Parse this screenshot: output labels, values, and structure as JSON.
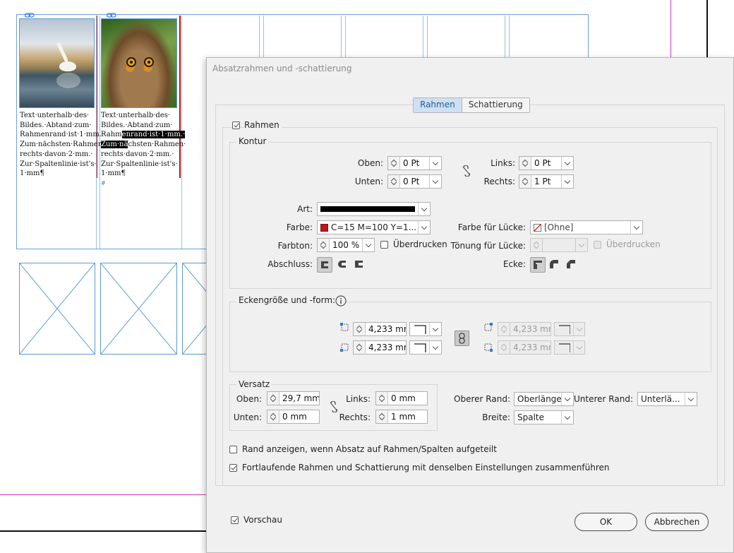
{
  "document": {
    "captions": [
      [
        "Text·unterhalb·des·",
        "Bildes.·Abtand·zum·",
        "Rahmenrand·ist·1·mm.·",
        "Zum·nächsten·Rahmen·",
        "rechts·davon·2·mm.·",
        "Zur·Spaltenlinie·ist's·",
        "1·mm¶"
      ],
      [
        "Text·unterhalb·des·",
        "Bildes.·Abtand·zum·",
        "Rahm",
        "enrand·ist·1·mm.·",
        "Zum·nä",
        "chsten·Rahmen·",
        "rechts·davon·2·mm.·",
        "Zur·Spaltenlinie·ist's·",
        "1·mm¶",
        "#"
      ]
    ],
    "images": [
      "swan-photo",
      "owl-photo"
    ]
  },
  "dialog": {
    "title": "Absatzrahmen und -schattierung",
    "tabs": [
      {
        "label": "Rahmen",
        "active": true
      },
      {
        "label": "Schattierung",
        "active": false
      }
    ],
    "rahmen": {
      "label": "Rahmen",
      "checked": true
    },
    "kontur": {
      "label": "Kontur",
      "oben_label": "Oben:",
      "oben_value": "0 Pt",
      "unten_label": "Unten:",
      "unten_value": "0 Pt",
      "links_label": "Links:",
      "links_value": "0 Pt",
      "rechts_label": "Rechts:",
      "rechts_value": "1 Pt",
      "art_label": "Art:",
      "farbe_label": "Farbe:",
      "farbe_value": "C=15 M=100 Y=1...",
      "farbe_swatch": "#c0161c",
      "farbe_luecke_label": "Farbe für Lücke:",
      "farbe_luecke_value": "[Ohne]",
      "farbton_label": "Farbton:",
      "farbton_value": "100 %",
      "ueberdrucken_label": "Überdrucken",
      "toenung_label": "Tönung für Lücke:",
      "ueberdrucken2_label": "Überdrucken",
      "abschluss_label": "Abschluss:",
      "ecke_label": "Ecke:"
    },
    "ecken": {
      "label": "Eckengröße und -form:",
      "tl_value": "4,233 mm",
      "bl_value": "4,233 mm",
      "tr_value": "4,233 mm",
      "br_value": "4,233 mm"
    },
    "versatz": {
      "label": "Versatz",
      "oben_label": "Oben:",
      "oben_value": "29,7 mm",
      "unten_label": "Unten:",
      "unten_value": "0 mm",
      "links_label": "Links:",
      "links_value": "0 mm",
      "rechts_label": "Rechts:",
      "rechts_value": "1 mm"
    },
    "oberer_rand_label": "Oberer Rand:",
    "oberer_rand_value": "Oberlänge",
    "unterer_rand_label": "Unterer Rand:",
    "unterer_rand_value": "Unterlä...",
    "breite_label": "Breite:",
    "breite_value": "Spalte",
    "rand_anzeigen": {
      "label": "Rand anzeigen, wenn Absatz auf Rahmen/Spalten aufgeteilt",
      "checked": false
    },
    "fortlaufend": {
      "label": "Fortlaufende Rahmen und Schattierung mit denselben Einstellungen zusammenführen",
      "checked": true
    },
    "vorschau": {
      "label": "Vorschau",
      "checked": true
    },
    "ok_label": "OK",
    "cancel_label": "Abbrechen"
  },
  "colors": {
    "accent": "#1f5c99",
    "frame_blue": "#5c9ad6",
    "rule_red": "#b5121b",
    "margin_magenta": "#cc33cc"
  }
}
